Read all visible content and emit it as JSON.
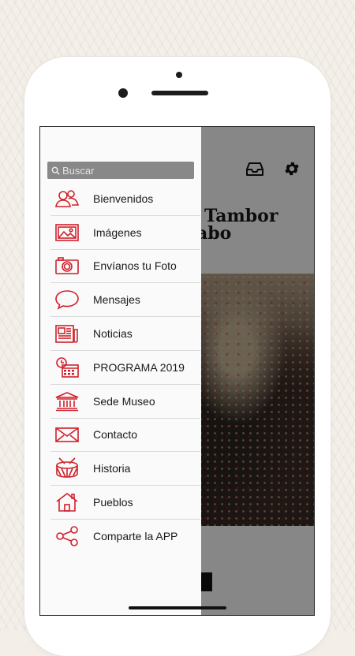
{
  "app": {
    "title_line1": "Tambor",
    "title_line2": "abo"
  },
  "drawer": {
    "search_placeholder": "Buscar",
    "items": [
      {
        "label": "Bienvenidos",
        "icon": "users-icon"
      },
      {
        "label": "Imágenes",
        "icon": "image-icon"
      },
      {
        "label": "Envíanos tu Foto",
        "icon": "camera-icon"
      },
      {
        "label": "Mensajes",
        "icon": "chat-bubble-icon"
      },
      {
        "label": "Noticias",
        "icon": "newspaper-icon"
      },
      {
        "label": "PROGRAMA 2019",
        "icon": "calendar-clock-icon"
      },
      {
        "label": "Sede Museo",
        "icon": "museum-icon"
      },
      {
        "label": "Contacto",
        "icon": "envelope-icon"
      },
      {
        "label": "Historia",
        "icon": "drum-icon"
      },
      {
        "label": "Pueblos",
        "icon": "house-icon"
      },
      {
        "label": "Comparte la APP",
        "icon": "share-icon"
      }
    ]
  },
  "colors": {
    "accent": "#d0202a",
    "drawer_bg": "#fafafa",
    "search_bg": "#888888"
  }
}
